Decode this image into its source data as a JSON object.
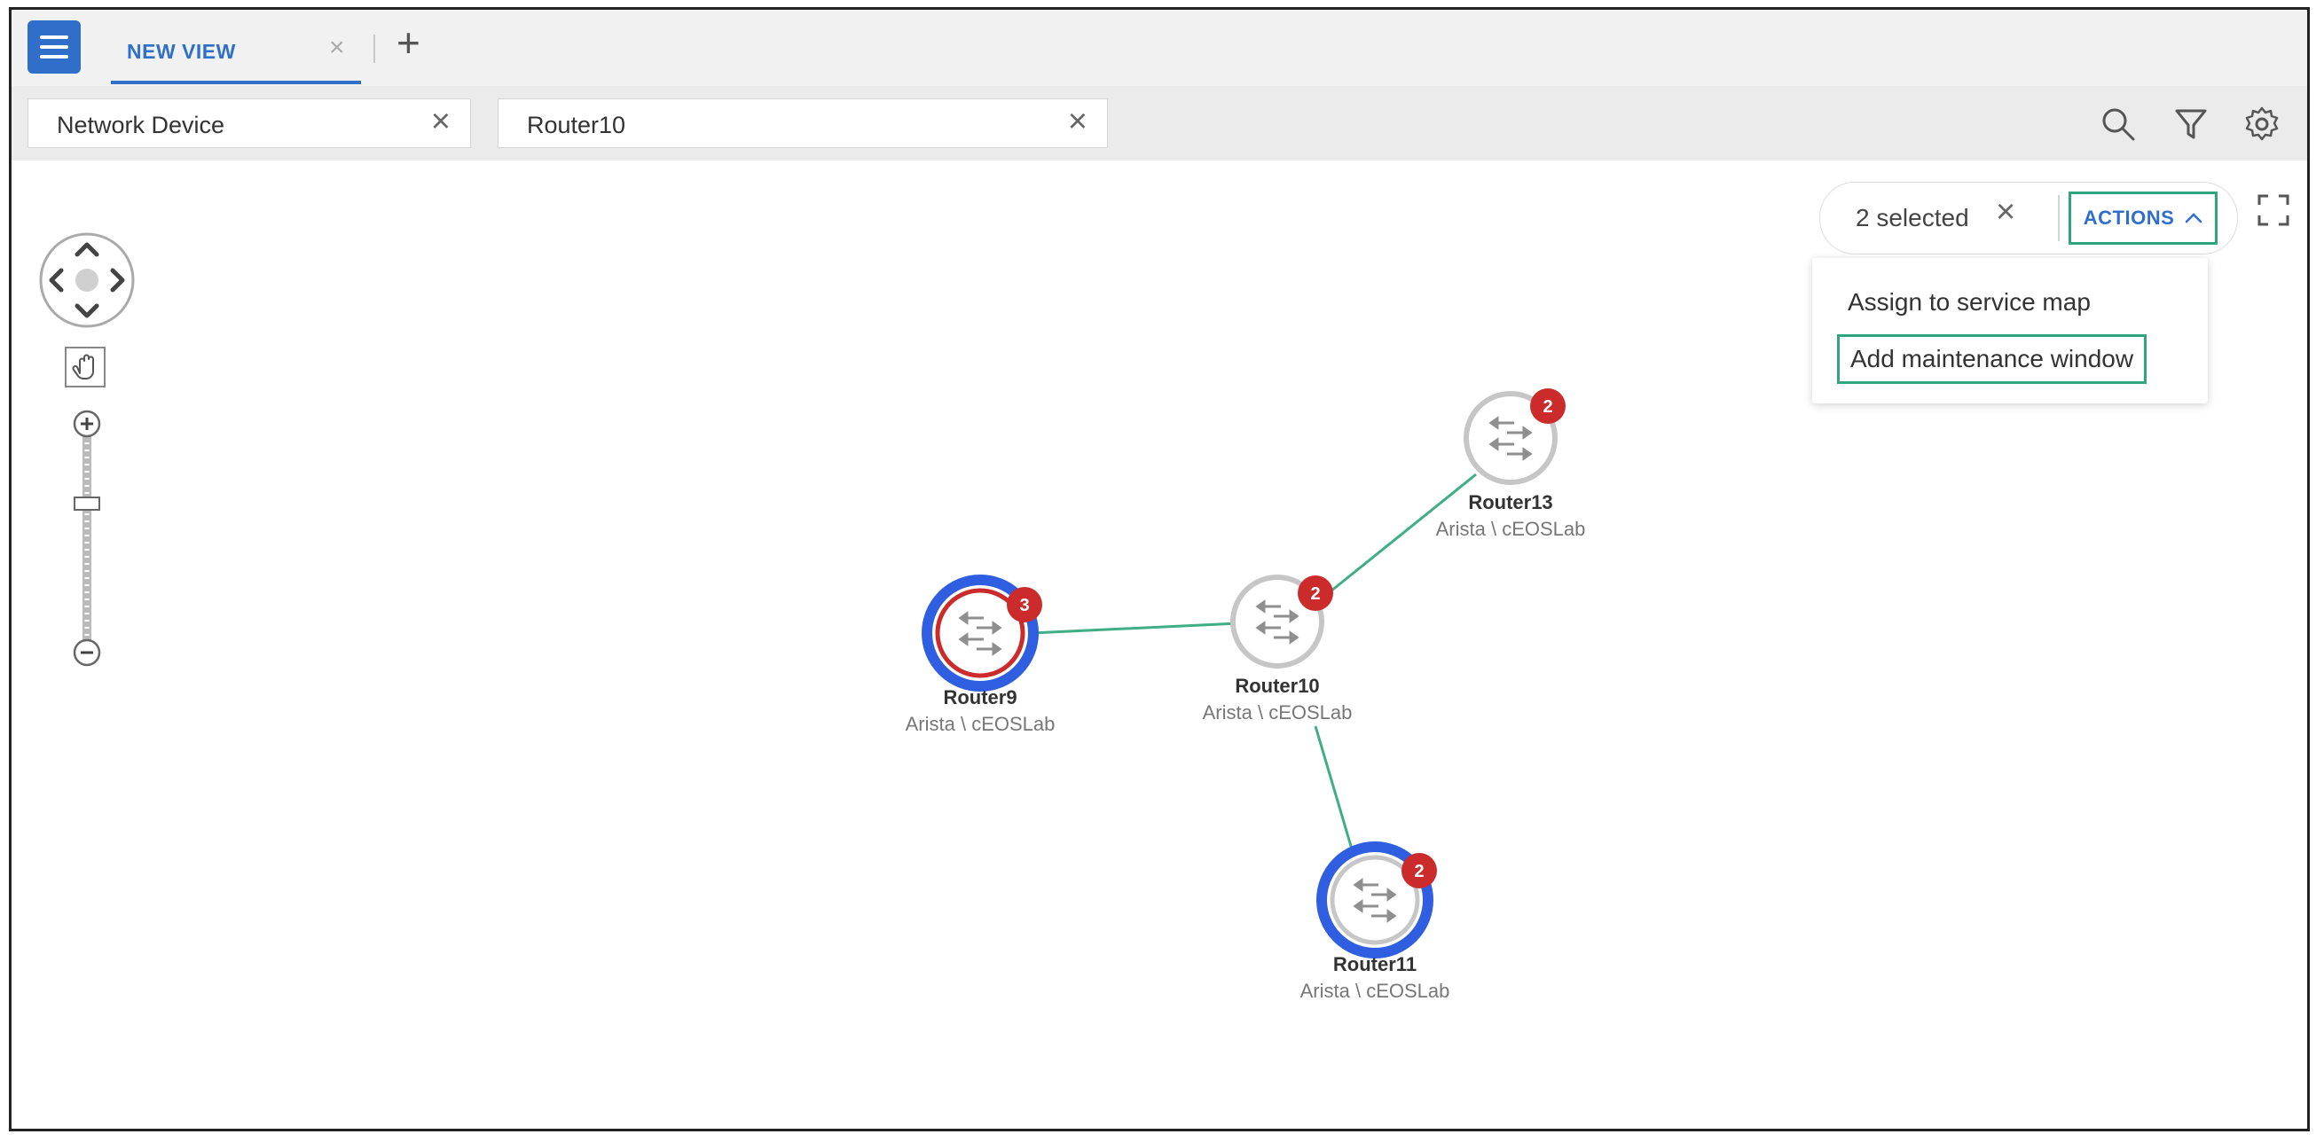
{
  "tabs": {
    "active_label": "NEW VIEW"
  },
  "filters": [
    {
      "label": "Network Device"
    },
    {
      "label": "Router10"
    }
  ],
  "selection": {
    "count_label": "2 selected",
    "actions_label": "ACTIONS"
  },
  "actions_menu": {
    "items": [
      {
        "label": "Assign to service map"
      },
      {
        "label": "Add maintenance window"
      }
    ]
  },
  "nodes": [
    {
      "name": "Router13",
      "subtitle": "Arista \\ cEOSLab",
      "alerts": "2",
      "selected": false
    },
    {
      "name": "Router10",
      "subtitle": "Arista \\ cEOSLab",
      "alerts": "2",
      "selected": false
    },
    {
      "name": "Router9",
      "subtitle": "Arista \\ cEOSLab",
      "alerts": "3",
      "selected": true
    },
    {
      "name": "Router11",
      "subtitle": "Arista \\ cEOSLab",
      "alerts": "2",
      "selected": true
    }
  ],
  "icons": {
    "menu": "hamburger-icon",
    "add_tab": "plus-icon",
    "search": "search-icon",
    "filter": "funnel-icon",
    "settings": "gear-icon",
    "fullscreen": "fullscreen-icon",
    "pan": "pan-arrows-icon",
    "hand": "hand-icon",
    "zoom_in": "zoom-in-icon",
    "zoom_out": "zoom-out-icon"
  },
  "colors": {
    "accent_blue": "#2f6fc9",
    "highlight_green": "#2fa47e",
    "link_green": "#3fae84",
    "alert_red": "#cc2b2b",
    "selection_blue": "#2f5fe0"
  }
}
